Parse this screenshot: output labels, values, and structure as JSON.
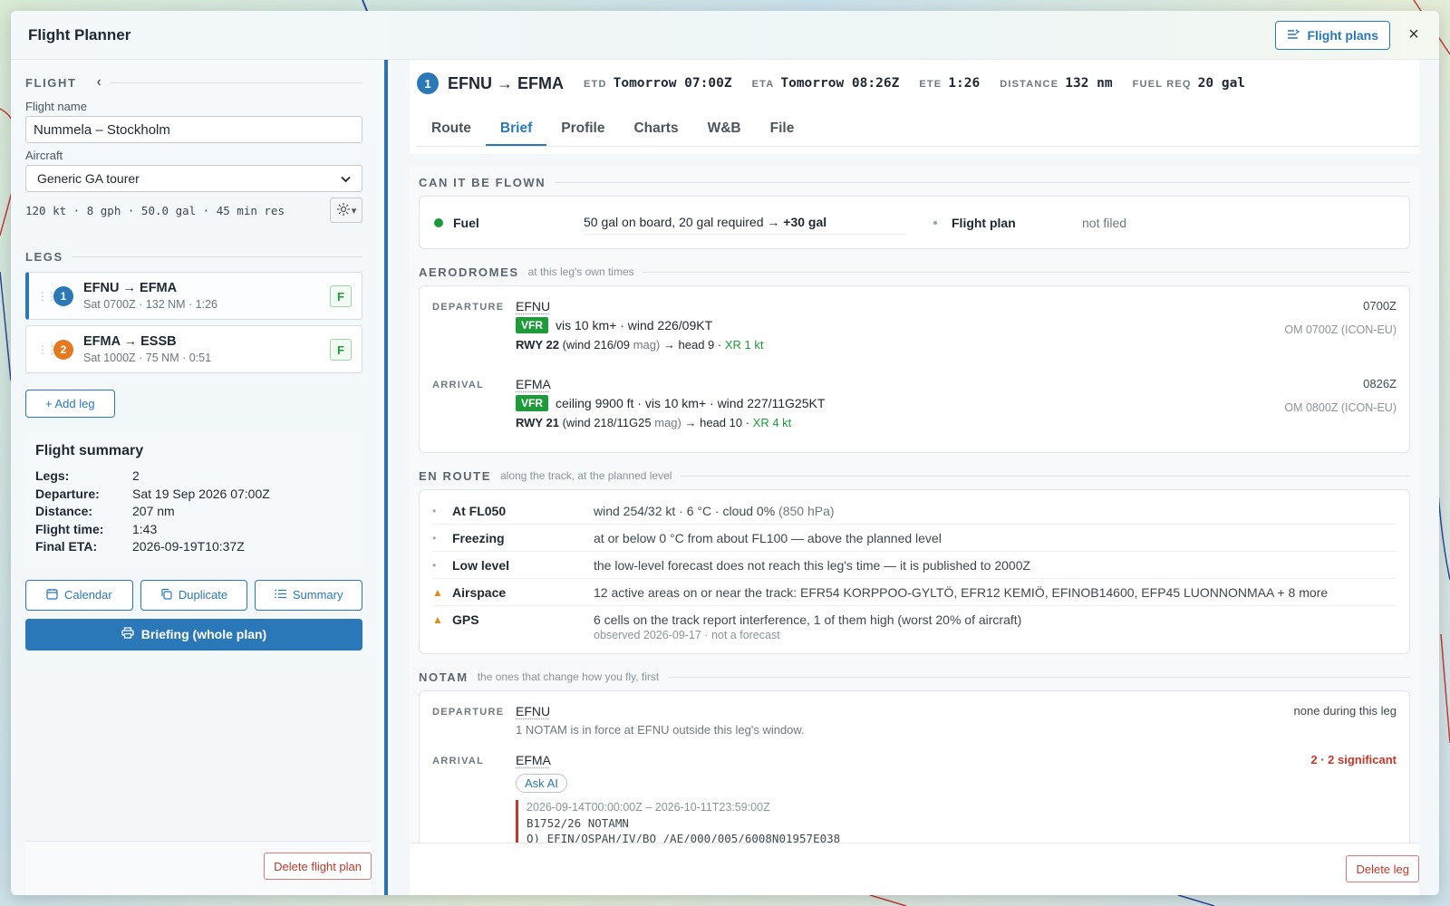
{
  "panel": {
    "title": "Flight Planner",
    "flight_plans_label": "Flight plans",
    "close_label": "×"
  },
  "left": {
    "flight_heading": "FLIGHT",
    "collapse_icon": "‹",
    "flight_name_label": "Flight name",
    "flight_name_value": "Nummela – Stockholm",
    "aircraft_label": "Aircraft",
    "aircraft_value": "Generic GA tourer",
    "aircraft_stats": "120 kt · 8 gph · 50.0 gal · 45 min res",
    "legs_heading": "LEGS",
    "legs": [
      {
        "num": "1",
        "title": "EFNU → EFMA",
        "sub": "Sat 0700Z · 132 NM · 1:26",
        "badge": "F",
        "color": "#2a78b8"
      },
      {
        "num": "2",
        "title": "EFMA → ESSB",
        "sub": "Sat 1000Z · 75 NM · 0:51",
        "badge": "F",
        "color": "#e5791f"
      }
    ],
    "add_leg_label": "+ Add leg",
    "summary": {
      "title": "Flight summary",
      "rows": [
        {
          "k": "Legs:",
          "v": "2"
        },
        {
          "k": "Departure:",
          "v": "Sat 19 Sep 2026 07:00Z"
        },
        {
          "k": "Distance:",
          "v": "207 nm"
        },
        {
          "k": "Flight time:",
          "v": "1:43"
        },
        {
          "k": "Final ETA:",
          "v": "2026-09-19T10:37Z"
        }
      ]
    },
    "calendar_label": "Calendar",
    "duplicate_label": "Duplicate",
    "summary_label": "Summary",
    "briefing_label": "Briefing (whole plan)",
    "delete_plan_label": "Delete flight plan"
  },
  "leg": {
    "num": "1",
    "route": "EFNU → EFMA",
    "etd_k": "ETD",
    "etd_v": "Tomorrow 07:00Z",
    "eta_k": "ETA",
    "eta_v": "Tomorrow 08:26Z",
    "ete_k": "ETE",
    "ete_v": "1:26",
    "dist_k": "DISTANCE",
    "dist_v": "132 nm",
    "fuel_k": "FUEL REQ",
    "fuel_v": "20 gal",
    "tabs": [
      "Route",
      "Brief",
      "Profile",
      "Charts",
      "W&B",
      "File"
    ],
    "active_tab": "Brief"
  },
  "brief": {
    "can_fly": {
      "title": "CAN IT BE FLOWN",
      "fuel_name": "Fuel",
      "fuel_text": "50 gal on board, 20 gal required",
      "fuel_margin": "→ +30 gal",
      "plan_name": "Flight plan",
      "plan_text": "not filed"
    },
    "aerodromes": {
      "title": "AERODROMES",
      "subtitle": "at this leg's own times",
      "departure": {
        "label": "DEPARTURE",
        "icao": "EFNU",
        "cat": "VFR",
        "wx": "vis 10 km+ · wind 226/09KT",
        "rwy": "RWY 22",
        "rwy_wind": "(wind 216/09",
        "rwy_mag": "mag)",
        "rwy_head": "→ head 9 ·",
        "rwy_xr": "XR 1 kt",
        "time": "0700Z",
        "model": "OM 0700Z (ICON-EU)"
      },
      "arrival": {
        "label": "ARRIVAL",
        "icao": "EFMA",
        "cat": "VFR",
        "wx": "ceiling 9900 ft · vis 10 km+ · wind 227/11G25KT",
        "rwy": "RWY 21",
        "rwy_wind": "(wind 218/11G25",
        "rwy_mag": "mag)",
        "rwy_head": "→ head 10 ·",
        "rwy_xr": "XR 4 kt",
        "time": "0826Z",
        "model": "OM 0800Z (ICON-EU)"
      }
    },
    "en_route": {
      "title": "EN ROUTE",
      "subtitle": "along the track, at the planned level",
      "rows": [
        {
          "mark": "•",
          "name": "At FL050",
          "text": "wind 254/32 kt · 6 °C · cloud 0%",
          "extra": "(850 hPa)",
          "sub": ""
        },
        {
          "mark": "•",
          "name": "Freezing",
          "text": "at or below 0 °C from about FL100 — above the planned level",
          "extra": "",
          "sub": ""
        },
        {
          "mark": "•",
          "name": "Low level",
          "text": "the low-level forecast does not reach this leg's time — it is published to 2000Z",
          "extra": "",
          "sub": ""
        },
        {
          "mark": "▲",
          "name": "Airspace",
          "text": "12 active areas on or near the track: EFR54 KORPPOO-GYLTÖ, EFR12 KEMIÖ, EFINOB14600, EFP45 LUONNONMAA + 8 more",
          "extra": "",
          "sub": ""
        },
        {
          "mark": "▲",
          "name": "GPS",
          "text": "6 cells on the track report interference, 1 of them high (worst 20% of aircraft)",
          "extra": "",
          "sub": "observed 2026-09-17 · not a forecast"
        }
      ]
    },
    "notam": {
      "title": "NOTAM",
      "subtitle": "the ones that change how you fly, first",
      "departure": {
        "label": "DEPARTURE",
        "icao": "EFNU",
        "text": "1 NOTAM is in force at EFNU outside this leg's window.",
        "status": "none during this leg"
      },
      "arrival": {
        "label": "ARRIVAL",
        "icao": "EFMA",
        "status": "2 · 2 significant",
        "ask": "Ask AI",
        "dates": "2026-09-14T00:00:00Z – 2026-10-11T23:59:00Z",
        "line1": "B1752/26 NOTAMN",
        "line2": "Q) EFIN/QSPAH/IV/BO /AE/000/005/6008N01957E038"
      }
    }
  },
  "delete_leg_label": "Delete leg",
  "colors": {
    "accent": "#2a78b8",
    "vfr": "#1d9a3a",
    "warn": "#e08a1e",
    "danger": "#c0392b"
  }
}
